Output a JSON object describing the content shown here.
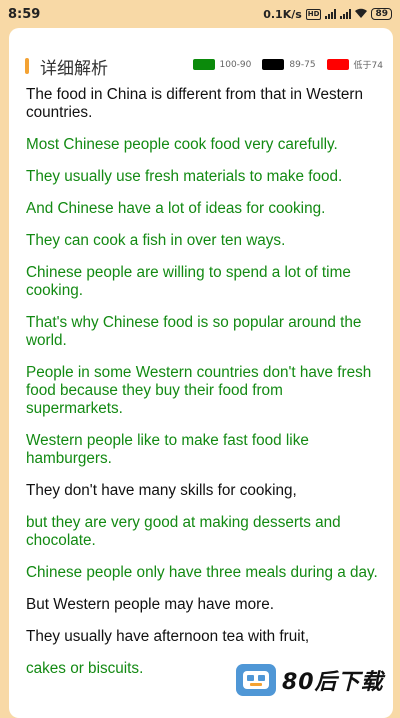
{
  "status_bar": {
    "time": "8:59",
    "network_speed": "0.1K/s",
    "hd_badge": "HD",
    "battery": "89"
  },
  "header": {
    "title": "详细解析",
    "accent_color": "#f3a233"
  },
  "legend": [
    {
      "label": "100-90",
      "color": "#0b8a0b"
    },
    {
      "label": "89-75",
      "color": "#000000"
    },
    {
      "label": "低于74",
      "color": "#ff0000"
    }
  ],
  "sentences": [
    {
      "text": "The food in China is different from that in Western countries.",
      "color": "#111111"
    },
    {
      "text": "Most Chinese people cook food very carefully.",
      "color": "#138a13"
    },
    {
      "text": "They usually use fresh materials to make food.",
      "color": "#138a13"
    },
    {
      "text": "And Chinese have a lot of ideas for cooking.",
      "color": "#138a13"
    },
    {
      "text": "They can cook a fish in over ten ways.",
      "color": "#138a13"
    },
    {
      "text": "Chinese people are willing to spend a lot of time cooking.",
      "color": "#138a13"
    },
    {
      "text": "That's why Chinese food is so popular around the world.",
      "color": "#138a13"
    },
    {
      "text": "People in some Western countries don't have fresh food because they buy their food from supermarkets.",
      "color": "#138a13"
    },
    {
      "text": "Western people like to make fast food like hamburgers.",
      "color": "#138a13"
    },
    {
      "text": "They don't have many skills for cooking,",
      "color": "#111111"
    },
    {
      "text": "but they are very good at making desserts and chocolate.",
      "color": "#138a13"
    },
    {
      "text": "Chinese people only have three meals during a day.",
      "color": "#138a13"
    },
    {
      "text": "But Western people may have more.",
      "color": "#111111"
    },
    {
      "text": "They usually have afternoon tea with fruit,",
      "color": "#111111"
    },
    {
      "text": "cakes or biscuits.",
      "color": "#138a13"
    }
  ],
  "watermark": {
    "text": "80后下载"
  }
}
